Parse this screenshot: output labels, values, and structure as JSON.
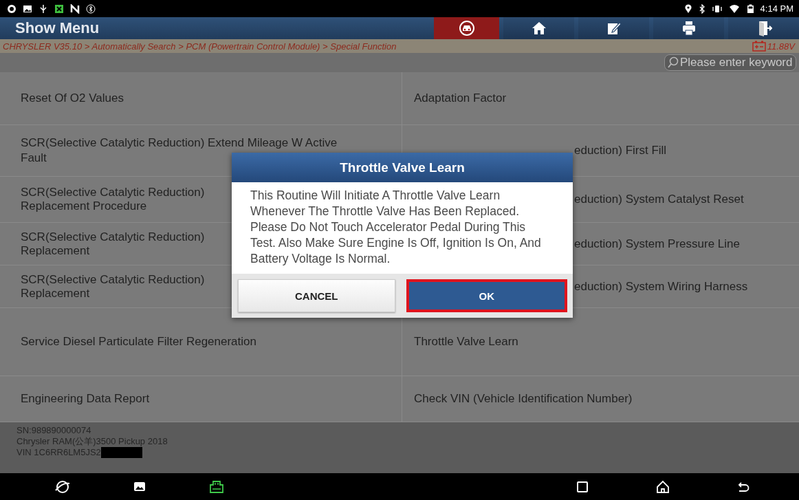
{
  "status_bar": {
    "time": "4:14 PM"
  },
  "header": {
    "title": "Show Menu",
    "tools": [
      {
        "kind": "car",
        "selected": true
      },
      {
        "kind": "home",
        "selected": false
      },
      {
        "kind": "edit",
        "selected": false
      },
      {
        "kind": "print",
        "selected": false
      },
      {
        "kind": "exit",
        "selected": false
      }
    ]
  },
  "breadcrumb": {
    "path": "CHRYSLER V35.10 > Automatically Search > PCM (Powertrain Control Module) > Special Function",
    "voltage": "11.88V"
  },
  "search": {
    "placeholder": "Please enter keyword"
  },
  "menu_rows": [
    {
      "left": {
        "text": "Reset Of O2 Values",
        "kind": "full"
      },
      "right": {
        "text": "Adaptation Factor",
        "kind": "full"
      }
    },
    {
      "left": {
        "text": "SCR(Selective Catalytic Reduction) Extend Mileage W Active Fault",
        "kind": "full"
      },
      "right": {
        "text": "eduction) First Fill",
        "kind": "clipped"
      }
    },
    {
      "left": {
        "text": "SCR(Selective Catalytic Reduction) Replacement Procedure",
        "kind": "clipped"
      },
      "right": {
        "text": "eduction) System Catalyst Reset",
        "kind": "clipped"
      }
    },
    {
      "left": {
        "text": "SCR(Selective Catalytic Reduction) Replacement",
        "kind": "clipped"
      },
      "right": {
        "text": "eduction) System Pressure Line",
        "kind": "clipped"
      }
    },
    {
      "left": {
        "text": "SCR(Selective Catalytic Reduction) Replacement",
        "kind": "clipped"
      },
      "right": {
        "text": "eduction) System Wiring Harness",
        "kind": "clipped"
      }
    },
    {
      "left": {
        "text": "Service Diesel Particulate Filter Regeneration",
        "kind": "full"
      },
      "right": {
        "text": "Throttle Valve Learn",
        "kind": "full"
      }
    },
    {
      "left": {
        "text": "Engineering Data Report",
        "kind": "full"
      },
      "right": {
        "text": "Check VIN (Vehicle Identification Number)",
        "kind": "full"
      }
    }
  ],
  "vehicle_info": {
    "lines": [
      "SN:989890000074",
      "Chrysler RAM(公羊)3500 Pickup 2018",
      "VIN 1C6RR6LM5JS2"
    ]
  },
  "dialog": {
    "title": "Throttle Valve Learn",
    "message": "This Routine Will Initiate A Throttle Valve Learn Whenever The Throttle Valve Has Been Replaced. Please Do Not Touch Accelerator Pedal During This Test. Also Make Sure Engine Is Off, Ignition Is On, And Battery Voltage Is Normal.",
    "buttons": [
      {
        "label": "CANCEL",
        "kind": "secondary",
        "highlighted": false
      },
      {
        "label": "OK",
        "kind": "primary",
        "highlighted": true
      }
    ]
  }
}
